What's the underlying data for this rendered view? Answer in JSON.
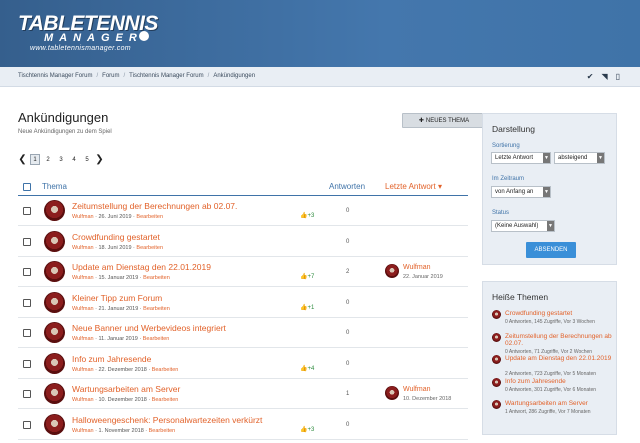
{
  "logo": {
    "line1": "TABLETENNIS",
    "line2": "MANAGER",
    "line3": "www.tabletennismanager.com"
  },
  "breadcrumb": [
    "Tischtennis Manager Forum",
    "Forum",
    "Tischtennis Manager Forum",
    "Ankündigungen"
  ],
  "page": {
    "title": "Ankündigungen",
    "subtitle": "Neue Ankündigungen zu dem Spiel",
    "new_topic": "NEUES THEMA"
  },
  "pagination": {
    "pages": [
      "1",
      "2",
      "3",
      "4",
      "5"
    ],
    "active": "1"
  },
  "table": {
    "col_topic": "Thema",
    "col_answers": "Antworten",
    "col_last": "Letzte Antwort"
  },
  "topics": [
    {
      "title": "Zeitumstellung der Berechnungen ab 02.07.",
      "user": "Wulfman",
      "date": "26. Juni 2019",
      "edit": "Bearbeiten",
      "likes": "+3",
      "answers": "0",
      "last_user": "",
      "last_date": ""
    },
    {
      "title": "Crowdfunding gestartet",
      "user": "Wulfman",
      "date": "18. Juni 2019",
      "edit": "Bearbeiten",
      "likes": "",
      "answers": "0",
      "last_user": "",
      "last_date": ""
    },
    {
      "title": "Update am Dienstag den 22.01.2019",
      "user": "Wulfman",
      "date": "15. Januar 2019",
      "edit": "Bearbeiten",
      "likes": "+7",
      "answers": "2",
      "last_user": "Wulfman",
      "last_date": "22. Januar 2019"
    },
    {
      "title": "Kleiner Tipp zum Forum",
      "user": "Wulfman",
      "date": "21. Januar 2019",
      "edit": "Bearbeiten",
      "likes": "+1",
      "answers": "0",
      "last_user": "",
      "last_date": ""
    },
    {
      "title": "Neue Banner und Werbevideos integriert",
      "user": "Wulfman",
      "date": "11. Januar 2019",
      "edit": "Bearbeiten",
      "likes": "",
      "answers": "0",
      "last_user": "",
      "last_date": ""
    },
    {
      "title": "Info zum Jahresende",
      "user": "Wulfman",
      "date": "22. Dezember 2018",
      "edit": "Bearbeiten",
      "likes": "+4",
      "answers": "0",
      "last_user": "",
      "last_date": ""
    },
    {
      "title": "Wartungsarbeiten am Server",
      "user": "Wulfman",
      "date": "10. Dezember 2018",
      "edit": "Bearbeiten",
      "likes": "",
      "answers": "1",
      "last_user": "Wulfman",
      "last_date": "10. Dezember 2018"
    },
    {
      "title": "Halloweengeschenk: Personalwartezeiten verkürzt",
      "user": "Wulfman",
      "date": "1. November 2018",
      "edit": "Bearbeiten",
      "likes": "+3",
      "answers": "0",
      "last_user": "",
      "last_date": ""
    }
  ],
  "display": {
    "title": "Darstellung",
    "sort_label": "Sortierung",
    "sort_value": "Letzte Antwort",
    "order_value": "absteigend",
    "range_label": "Im Zeitraum",
    "range_value": "von Anfang an",
    "status_label": "Status",
    "status_value": "(Keine Auswahl)",
    "apply": "ABSENDEN"
  },
  "hot": {
    "title": "Heiße Themen",
    "items": [
      {
        "title": "Crowdfunding gestartet",
        "meta": "0 Antworten, 145 Zugriffe, Vor 3 Wochen"
      },
      {
        "title": "Zeitumstellung der Berechnungen ab 02.07.",
        "meta": "0 Antworten, 71 Zugriffe, Vor 2 Wochen"
      },
      {
        "title": "Update am Dienstag den 22.01.2019",
        "meta": "2 Antworten, 723 Zugriffe, Vor 5 Monaten"
      },
      {
        "title": "Info zum Jahresende",
        "meta": "0 Antworten, 301 Zugriffe, Vor 6 Monaten"
      },
      {
        "title": "Wartungsarbeiten am Server",
        "meta": "1 Antwort, 286 Zugriffe, Vor 7 Monaten"
      }
    ]
  },
  "colors": {
    "header": "#3f73a8",
    "link": "#e2622a",
    "accent": "#3a8fd8"
  }
}
